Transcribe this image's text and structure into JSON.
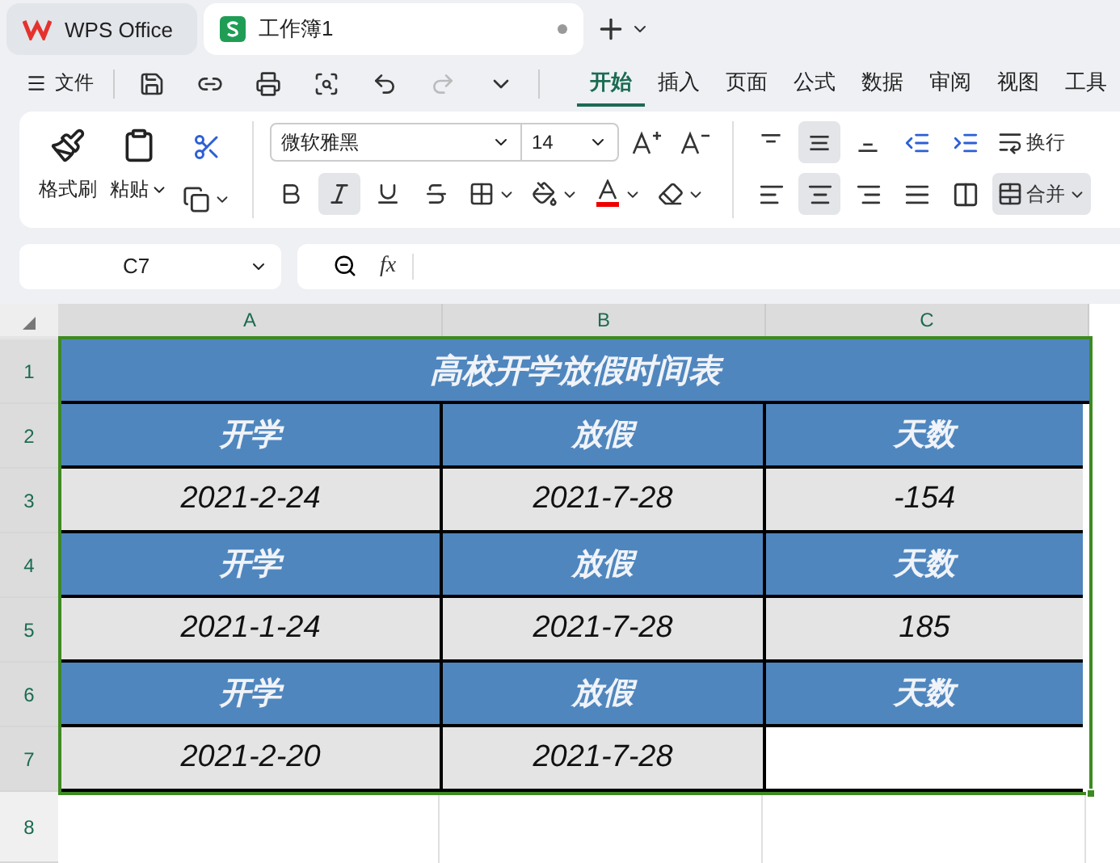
{
  "tabs": [
    {
      "label": "WPS Office",
      "kind": "home",
      "selected": false
    },
    {
      "label": "工作簿1",
      "kind": "sheet",
      "selected": true,
      "unsaved": true
    }
  ],
  "menu": {
    "file": "文件"
  },
  "ribbon_tabs": [
    {
      "label": "开始",
      "selected": true
    },
    {
      "label": "插入",
      "selected": false
    },
    {
      "label": "页面",
      "selected": false
    },
    {
      "label": "公式",
      "selected": false
    },
    {
      "label": "数据",
      "selected": false
    },
    {
      "label": "审阅",
      "selected": false
    },
    {
      "label": "视图",
      "selected": false
    },
    {
      "label": "工具",
      "selected": false
    }
  ],
  "clipboard": {
    "format_painter": "格式刷",
    "paste": "粘贴"
  },
  "font": {
    "name": "微软雅黑",
    "size": "14"
  },
  "format_buttons": [
    {
      "kind": "bold",
      "selected": false
    },
    {
      "kind": "italic",
      "selected": true
    },
    {
      "kind": "underline",
      "selected": false
    },
    {
      "kind": "strike",
      "selected": false
    }
  ],
  "align_top": [
    {
      "kind": "top",
      "selected": false
    },
    {
      "kind": "middle",
      "selected": true
    },
    {
      "kind": "bottom",
      "selected": false
    },
    {
      "kind": "outdent",
      "selected": false
    },
    {
      "kind": "indent",
      "selected": false
    }
  ],
  "align_bottom": [
    {
      "kind": "left",
      "selected": false
    },
    {
      "kind": "center",
      "selected": true
    },
    {
      "kind": "right",
      "selected": false
    },
    {
      "kind": "justify",
      "selected": false
    },
    {
      "kind": "distributed",
      "selected": false
    }
  ],
  "wrap": "换行",
  "merge": {
    "label": "合并",
    "selected": true
  },
  "name_box": "C7",
  "fx": "fx",
  "sheet": {
    "columns": [
      "A",
      "B",
      "C"
    ],
    "row_numbers": [
      "1",
      "2",
      "3",
      "4",
      "5",
      "6",
      "7",
      "8"
    ],
    "title": "高校开学放假时间表",
    "rows": [
      {
        "kind": "header",
        "cells": [
          {
            "text": "开学",
            "selected": false
          },
          {
            "text": "放假",
            "selected": false
          },
          {
            "text": "天数",
            "selected": false
          }
        ]
      },
      {
        "kind": "data",
        "cells": [
          {
            "text": "2021-2-24",
            "selected": false
          },
          {
            "text": "2021-7-28",
            "selected": false
          },
          {
            "text": "-154",
            "selected": false
          }
        ]
      },
      {
        "kind": "header",
        "cells": [
          {
            "text": "开学",
            "selected": false
          },
          {
            "text": "放假",
            "selected": false
          },
          {
            "text": "天数",
            "selected": false
          }
        ]
      },
      {
        "kind": "data",
        "cells": [
          {
            "text": "2021-1-24",
            "selected": false
          },
          {
            "text": "2021-7-28",
            "selected": false
          },
          {
            "text": "185",
            "selected": false
          }
        ]
      },
      {
        "kind": "header",
        "cells": [
          {
            "text": "开学",
            "selected": false
          },
          {
            "text": "放假",
            "selected": false
          },
          {
            "text": "天数",
            "selected": false
          }
        ]
      },
      {
        "kind": "data",
        "cells": [
          {
            "text": "2021-2-20",
            "selected": false
          },
          {
            "text": "2021-7-28",
            "selected": false
          },
          {
            "selected": true
          }
        ]
      }
    ]
  }
}
